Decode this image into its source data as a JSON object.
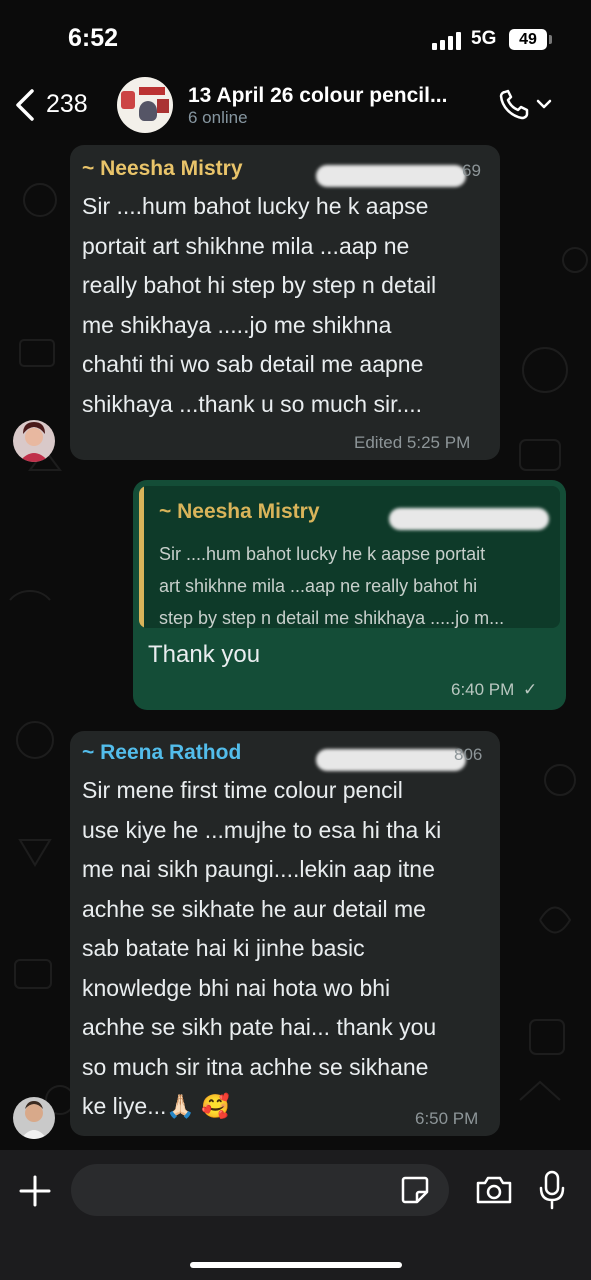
{
  "status_bar": {
    "time": "6:52",
    "network": "5G",
    "battery": "49"
  },
  "header": {
    "back_count": "238",
    "title": "13 April 26 colour pencil...",
    "subtitle": "6 online"
  },
  "messages": [
    {
      "sender": "~ Neesha Mistry",
      "sender_color": "#e9c46a",
      "phone_partial": "69",
      "text": "Sir ....hum  bahot lucky he k aapse portait art shikhne mila ...aap ne really bahot hi step by step n detail me shikhaya .....jo me shikhna chahti thi wo sab detail me aapne shikhaya ...thank u so much sir....",
      "lines": [
        "Sir ....hum  bahot lucky he k aapse",
        "portait art shikhne mila ...aap ne",
        "really bahot hi step by step n detail",
        "me shikhaya .....jo me shikhna",
        "chahti thi wo sab detail me aapne",
        "shikhaya ...thank u so much sir...."
      ],
      "meta": "Edited 5:25 PM"
    },
    {
      "outgoing": true,
      "quote_sender": "~ Neesha Mistry",
      "quote_lines": [
        "Sir ....hum  bahot lucky he k aapse portait",
        "art shikhne mila ...aap ne really bahot hi",
        "step by step n detail me shikhaya .....jo m..."
      ],
      "text": "Thank you",
      "meta": "6:40 PM",
      "check": "✓"
    },
    {
      "sender": "~ Reena Rathod",
      "sender_color": "#53bdeb",
      "phone_partial": "806",
      "text": "Sir mene first time colour pencil use kiye he ...mujhe to esa hi tha ki me nai sikh paungi....lekin aap itne achhe se sikhate he aur detail me sab batate hai ki jinhe basic knowledge bhi nai hota wo bhi achhe se sikh pate hai... thank you so much sir itna achhe se sikhane ke liye...🙏🏻 🥰",
      "lines": [
        "Sir mene first time colour pencil",
        "use kiye he ...mujhe to esa hi tha ki",
        "me nai sikh paungi....lekin aap itne",
        "achhe se sikhate he aur detail me",
        "sab batate hai ki jinhe basic",
        "knowledge bhi nai hota wo bhi",
        "achhe se sikh pate hai... thank you",
        "so much sir itna achhe se sikhane",
        "ke liye...🙏🏻 🥰"
      ],
      "meta": "6:50 PM"
    }
  ],
  "icons": {
    "back": "chevron-left-icon",
    "call": "phone-icon",
    "plus": "plus-icon",
    "sticker": "sticker-icon",
    "camera": "camera-icon",
    "mic": "microphone-icon"
  },
  "colors": {
    "incoming_bubble": "#232626",
    "outgoing_bubble": "#144d37",
    "background": "#0c0c0c"
  }
}
